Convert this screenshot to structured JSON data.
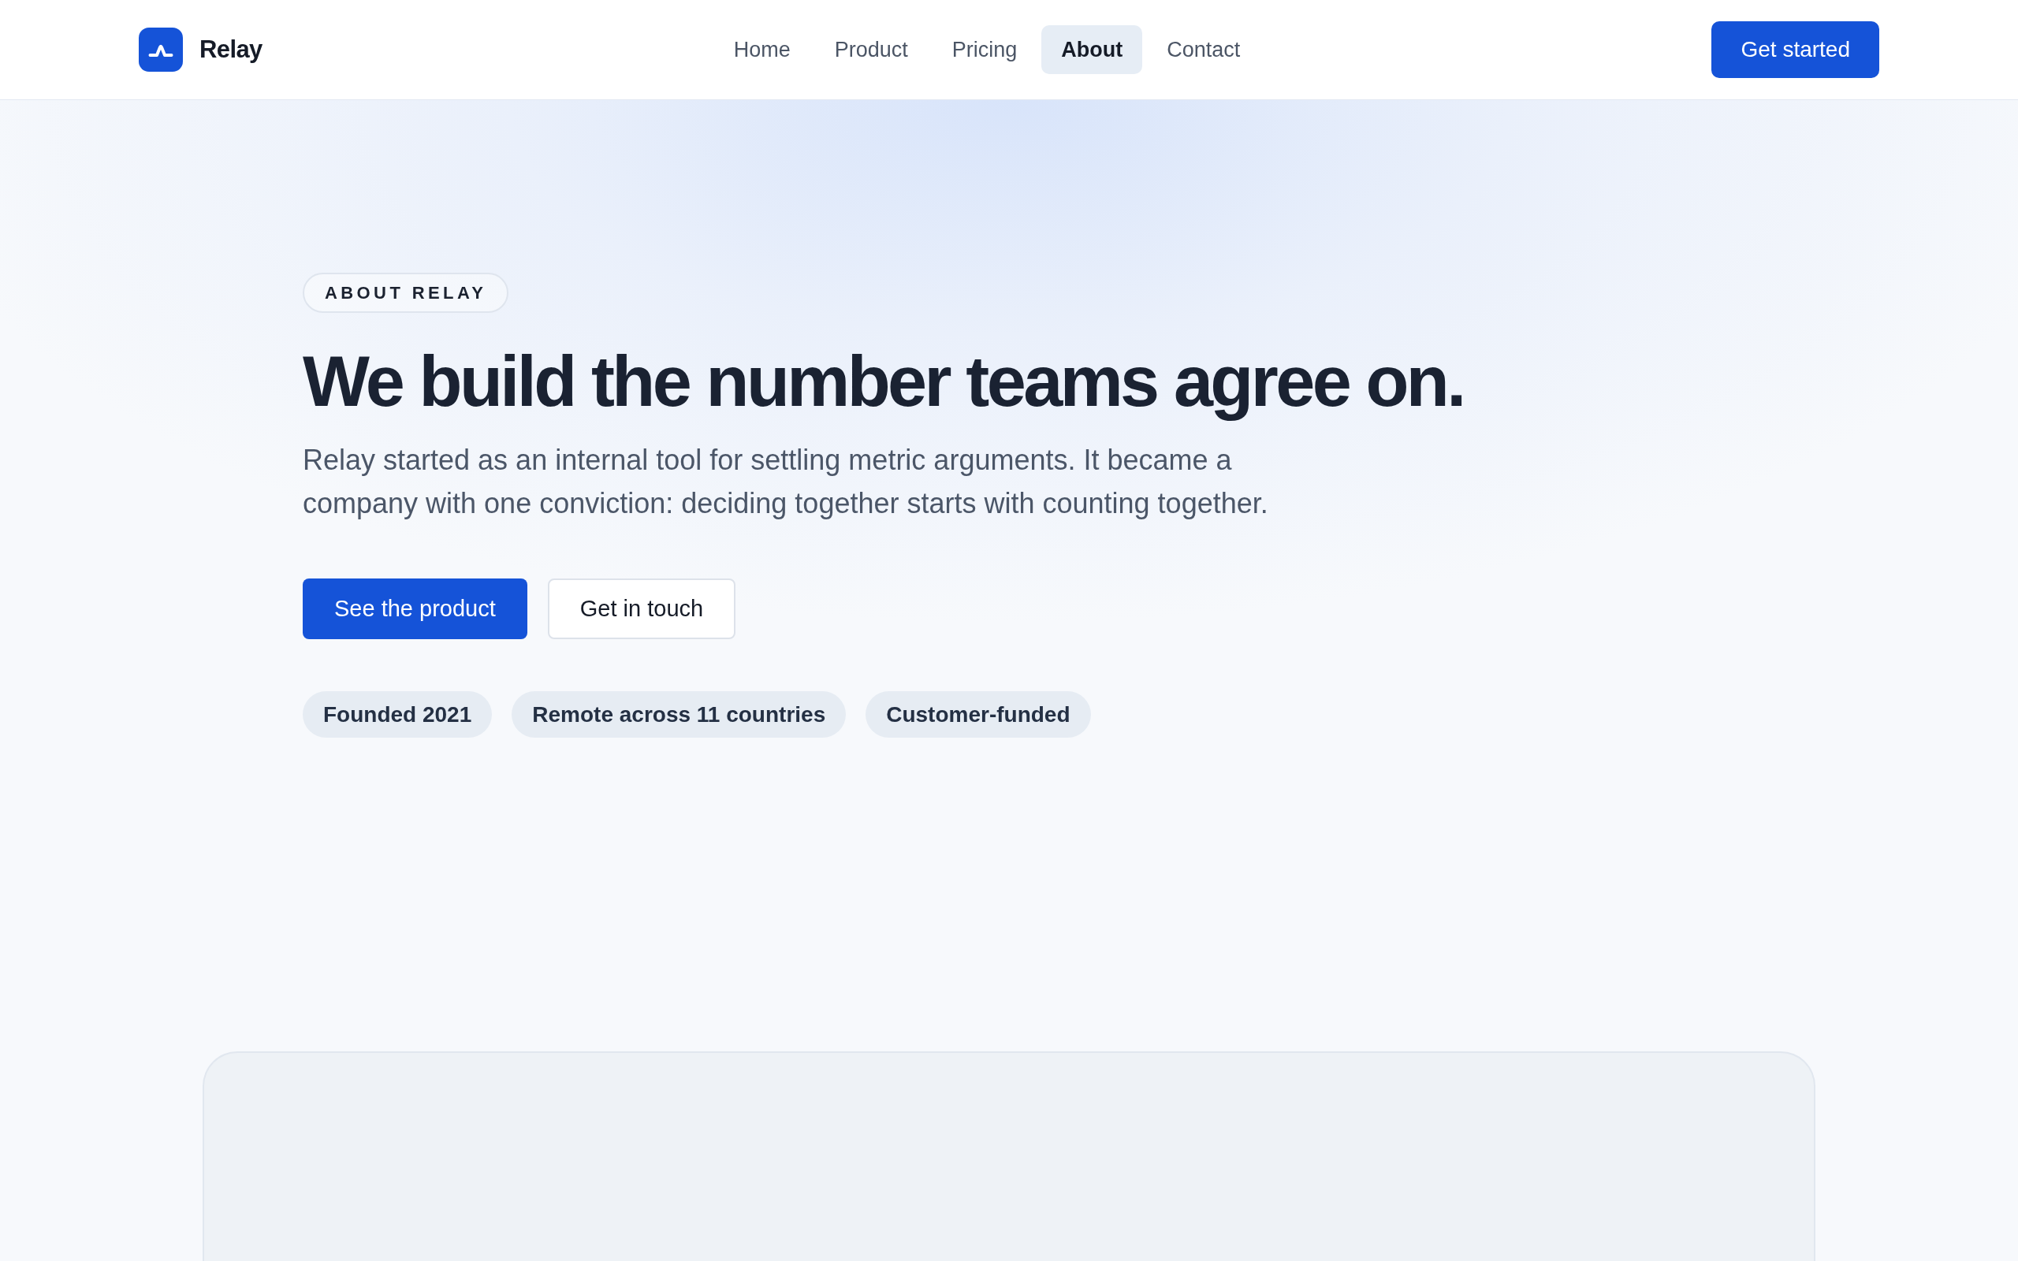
{
  "header": {
    "brand": "Relay",
    "nav": [
      {
        "label": "Home",
        "selected": false
      },
      {
        "label": "Product",
        "selected": false
      },
      {
        "label": "Pricing",
        "selected": false
      },
      {
        "label": "About",
        "selected": true
      },
      {
        "label": "Contact",
        "selected": false
      }
    ],
    "cta": "Get started"
  },
  "hero": {
    "eyebrow": "ABOUT RELAY",
    "title": "We build the number teams agree on.",
    "lead": "Relay started as an internal tool for settling metric arguments. It became a company with one conviction: deciding together starts with counting together.",
    "actions": [
      {
        "label": "See the product",
        "kind": "primary"
      },
      {
        "label": "Get in touch",
        "kind": "secondary"
      }
    ],
    "facts": [
      "Founded 2021",
      "Remote across 11 countries",
      "Customer-funded"
    ]
  }
}
